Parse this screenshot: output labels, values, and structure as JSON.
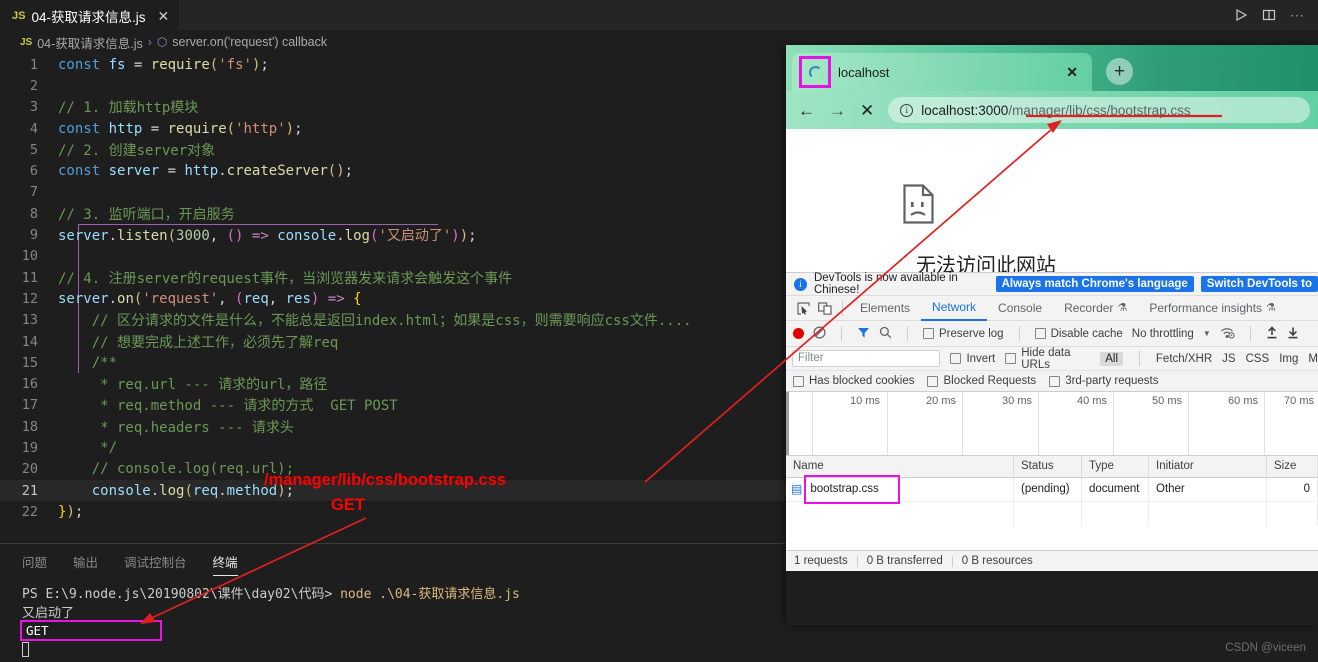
{
  "editor": {
    "tab": {
      "badge": "JS",
      "label": "04-获取请求信息.js",
      "close": "✕"
    },
    "actions": {
      "run": "▷",
      "split": "▯▯",
      "more": "⋯"
    },
    "breadcrumb": {
      "badge": "JS",
      "file": "04-获取请求信息.js",
      "sep": "›",
      "symbol": "server.on('request') callback"
    },
    "lines": [
      {
        "n": "1",
        "text": "const fs = require('fs');"
      },
      {
        "n": "2",
        "text": ""
      },
      {
        "n": "3",
        "text": "// 1. 加载http模块"
      },
      {
        "n": "4",
        "text": "const http = require('http');"
      },
      {
        "n": "5",
        "text": "// 2. 创建server对象"
      },
      {
        "n": "6",
        "text": "const server = http.createServer();"
      },
      {
        "n": "7",
        "text": ""
      },
      {
        "n": "8",
        "text": "// 3. 监听端口，开启服务"
      },
      {
        "n": "9",
        "text": "server.listen(3000, () => console.log('又启动了'));"
      },
      {
        "n": "10",
        "text": ""
      },
      {
        "n": "11",
        "text": "// 4. 注册server的request事件，当浏览器发来请求会触发这个事件"
      },
      {
        "n": "12",
        "text": "server.on('request', (req, res) => {"
      },
      {
        "n": "13",
        "text": "    // 区分请求的文件是什么，不能总是返回index.html；如果是css，则需要响应css文件...."
      },
      {
        "n": "14",
        "text": "    // 想要完成上述工作，必须先了解req"
      },
      {
        "n": "15",
        "text": "    /**"
      },
      {
        "n": "16",
        "text": "     * req.url --- 请求的url，路径"
      },
      {
        "n": "17",
        "text": "     * req.method --- 请求的方式  GET POST"
      },
      {
        "n": "18",
        "text": "     * req.headers --- 请求头"
      },
      {
        "n": "19",
        "text": "     */"
      },
      {
        "n": "20",
        "text": "    // console.log(req.url);"
      },
      {
        "n": "21",
        "text": "    console.log(req.method);"
      },
      {
        "n": "22",
        "text": "});"
      }
    ]
  },
  "panel": {
    "tabs": [
      {
        "label": "问题",
        "selected": false
      },
      {
        "label": "输出",
        "selected": false
      },
      {
        "label": "调试控制台",
        "selected": false
      },
      {
        "label": "终端",
        "selected": true
      }
    ],
    "terminal": {
      "prompt": "PS E:\\9.node.js\\20190802\\课件\\day02\\代码> ",
      "command": "node .\\04-获取请求信息.js",
      "output1": "又启动了",
      "output2": "GET"
    }
  },
  "watermark": "CSDN @viceen",
  "chrome": {
    "tab": {
      "title": "localhost",
      "close": "✕",
      "favicon": "loading-spinner-icon"
    },
    "newtab": "+",
    "nav": {
      "back": "←",
      "forward": "→",
      "stop": "✕"
    },
    "omnibox": {
      "info": "ⓘ",
      "host": "localhost:3000",
      "path": "/manager/lib/css/bootstrap.css"
    },
    "page": {
      "message": "无法访问此网站",
      "icon": "sad-document-icon"
    }
  },
  "devtools": {
    "banner": {
      "text": "DevTools is now available in Chinese!",
      "btn1": "Always match Chrome's language",
      "btn2": "Switch DevTools to"
    },
    "tabs": [
      {
        "label": "Elements",
        "selected": false,
        "flask": false
      },
      {
        "label": "Network",
        "selected": true,
        "flask": false
      },
      {
        "label": "Console",
        "selected": false,
        "flask": false
      },
      {
        "label": "Recorder",
        "selected": false,
        "flask": true
      },
      {
        "label": "Performance insights",
        "selected": false,
        "flask": true
      }
    ],
    "toolbar": {
      "record": "record-icon",
      "clear": "clear-icon",
      "filter_icon": "filter-icon",
      "search_icon": "search-icon",
      "preserve_log": "Preserve log",
      "disable_cache": "Disable cache",
      "throttling": "No throttling",
      "caret": "▼",
      "wifi": "wifi-settings-icon",
      "import": "↑",
      "export": "↓"
    },
    "filter": {
      "placeholder": "Filter",
      "invert": "Invert",
      "hide_data_urls": "Hide data URLs",
      "types": [
        "All",
        "Fetch/XHR",
        "JS",
        "CSS",
        "Img",
        "M"
      ]
    },
    "filter2": {
      "has_blocked_cookies": "Has blocked cookies",
      "blocked_requests": "Blocked Requests",
      "third_party": "3rd-party requests"
    },
    "timeline": {
      "ticks": [
        "10 ms",
        "20 ms",
        "30 ms",
        "40 ms",
        "50 ms",
        "60 ms",
        "70 ms"
      ]
    },
    "grid": {
      "headers": [
        "Name",
        "Status",
        "Type",
        "Initiator",
        "Size"
      ],
      "rows": [
        {
          "name": "bootstrap.css",
          "status": "(pending)",
          "type": "document",
          "initiator": "Other",
          "size": "0"
        }
      ]
    },
    "status": {
      "requests": "1 requests",
      "transferred": "0 B transferred",
      "resources": "0 B resources"
    }
  },
  "annotations": {
    "url_note": "/manager/lib/css/bootstrap.css",
    "method_note": "GET",
    "accent_magenta": "#e612e6",
    "accent_red": "#ff0000"
  }
}
